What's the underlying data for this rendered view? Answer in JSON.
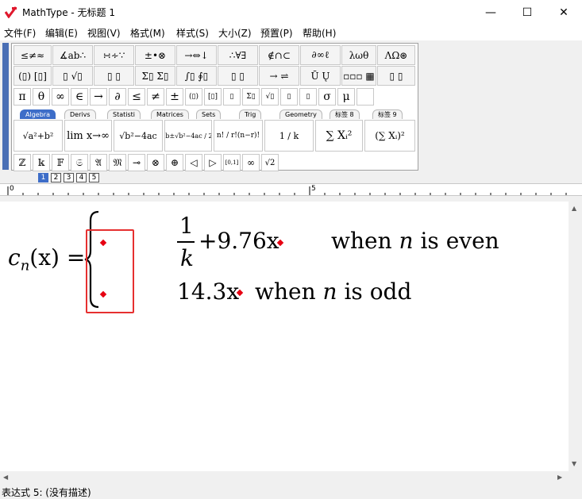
{
  "window": {
    "title": "MathType - 无标题 1",
    "min": "—",
    "max": "☐",
    "close": "✕"
  },
  "menu": [
    "文件(F)",
    "编辑(E)",
    "视图(V)",
    "格式(M)",
    "样式(S)",
    "大小(Z)",
    "预置(P)",
    "帮助(H)"
  ],
  "palette_row1": [
    "≤≠≈",
    "∡ab∴",
    "∺∻∵",
    "±•⊗",
    "→⇔↓",
    "∴∀∃",
    "∉∩⊂",
    "∂∞ℓ",
    "λωθ",
    "ΛΩ⊛"
  ],
  "palette_row2": [
    "(▯) [▯]",
    "▯ √▯",
    "▯ ▯",
    "Σ▯ Σ▯",
    "∫▯ ∮▯",
    "▯ ▯",
    "→ ⇌",
    "Ū Ų",
    "▫▫▫ ▦",
    "▯ ▯"
  ],
  "symbol_row": [
    "π",
    "θ",
    "∞",
    "∈",
    "→",
    "∂",
    "≤",
    "≠",
    "±",
    "(▯)",
    "[▯]",
    "▯",
    "Σ▯",
    "√▯",
    "▯",
    "▯",
    "σ",
    "μ",
    ""
  ],
  "tabs": [
    "Algebra",
    "Derivs",
    "Statisti",
    "Matrices",
    "Sets",
    "Trig",
    "Geometry",
    "标签 8",
    "标签 9"
  ],
  "templates": [
    "√a²+b²",
    "lim x→∞",
    "√b²−4ac",
    "−b±√b²−4ac / 2a",
    "n! / r!(n−r)!",
    "1 / k",
    "∑ Xᵢ²",
    "(∑ Xᵢ)²"
  ],
  "small_row": [
    "ℤ",
    "𝕜",
    "𝔽",
    "𝔖",
    "𝔄",
    "𝔐",
    "⊸",
    "⊗",
    "⊕",
    "◁",
    "▷",
    "[0,1]",
    "∞",
    "√2"
  ],
  "size_buttons": [
    "1",
    "2",
    "3",
    "4",
    "5"
  ],
  "ruler": {
    "mark0": "0",
    "mark5": "5"
  },
  "equation": {
    "lhs_c": "c",
    "lhs_sub": "n",
    "lhs_rest": "(x) =",
    "frac_num": "1",
    "frac_den": "k",
    "row1_expr": "+9.76x",
    "row1_when": "when",
    "row1_n": "n",
    "row1_tail": "is even",
    "row2_expr": "14.3x",
    "row2_when": "when",
    "row2_n": "n",
    "row2_tail": "is odd"
  },
  "status": "表达式 5: (没有描述)"
}
